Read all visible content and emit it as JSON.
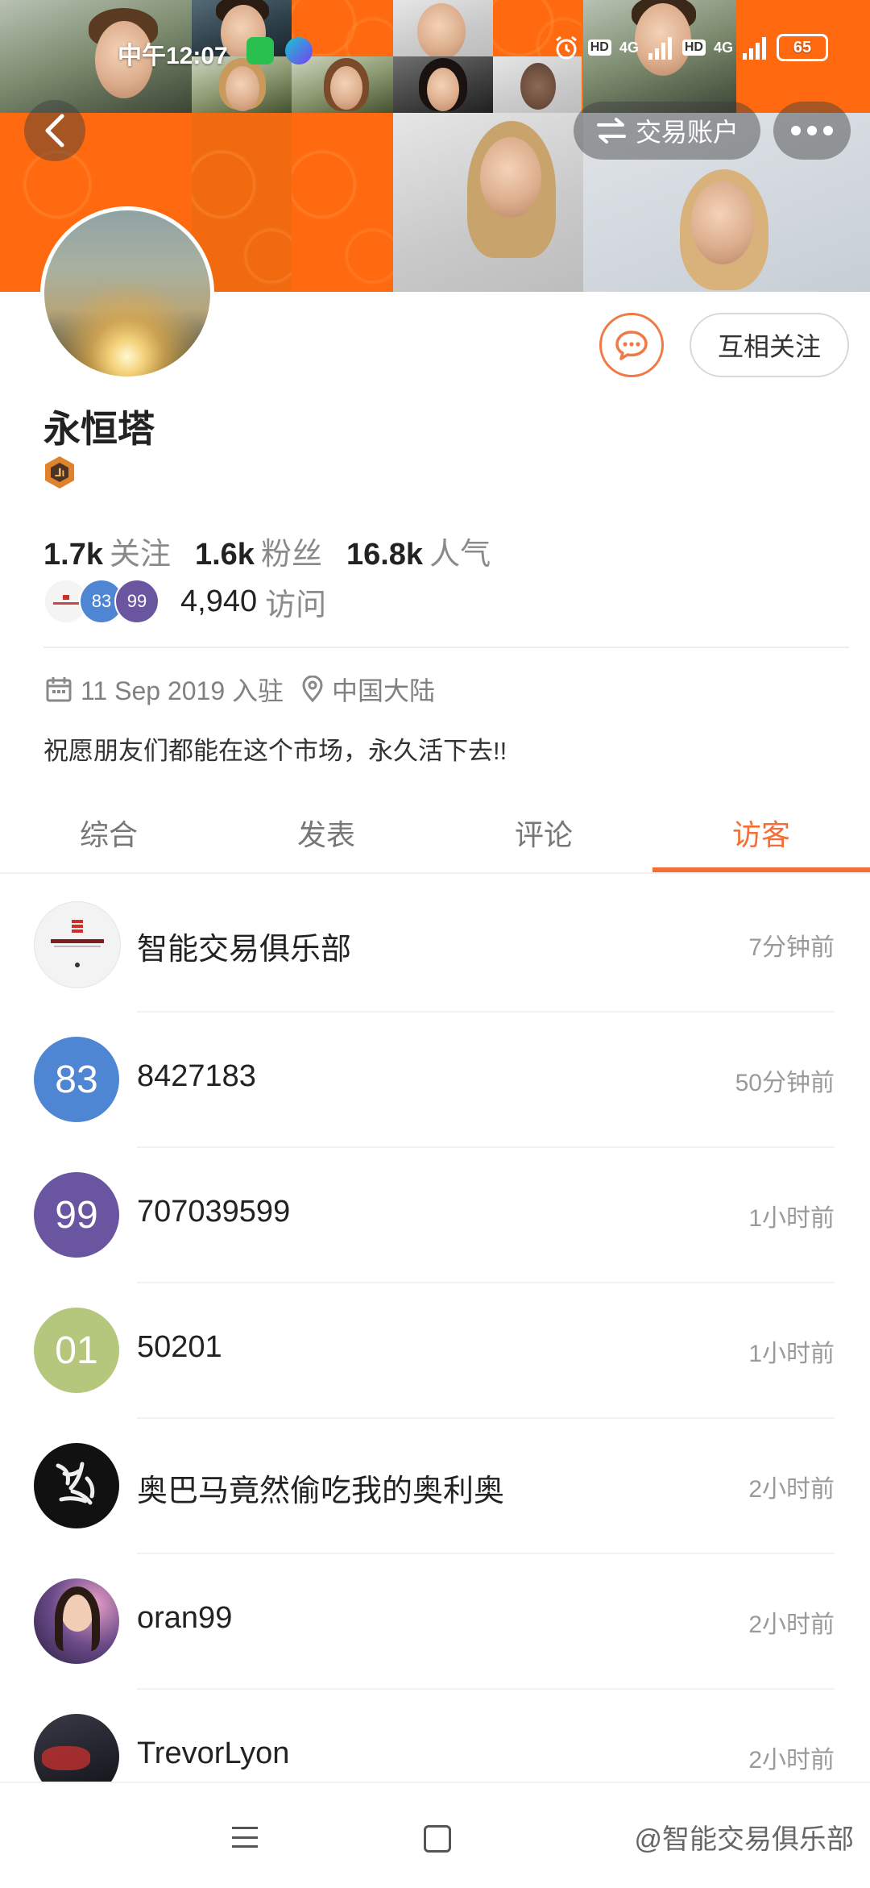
{
  "status_bar": {
    "time": "中午12:07",
    "battery": "65",
    "network_1": "4G",
    "network_2": "4G",
    "hd_1": "HD",
    "hd_2": "HD"
  },
  "header": {
    "switch_account": "交易账户"
  },
  "profile": {
    "username": "永恒塔",
    "follow_button": "互相关注",
    "stats": [
      {
        "value": "1.7k",
        "label": "关注"
      },
      {
        "value": "1.6k",
        "label": "粉丝"
      },
      {
        "value": "16.8k",
        "label": "人气"
      }
    ],
    "visitor_avatars": [
      "",
      "83",
      "99"
    ],
    "visit_count": "4,940",
    "visit_label": "访问",
    "joined": "11 Sep 2019 入驻",
    "location": "中国大陆",
    "bio": "祝愿朋友们都能在这个市场，永久活下去!!"
  },
  "tabs": [
    {
      "label": "综合",
      "active": false
    },
    {
      "label": "发表",
      "active": false
    },
    {
      "label": "评论",
      "active": false
    },
    {
      "label": "访客",
      "active": true
    }
  ],
  "visitors": [
    {
      "name": "智能交易俱乐部",
      "time": "7分钟前",
      "avatar_text": "",
      "avatar_color": "#f3f3f3",
      "avatar_kind": "logo"
    },
    {
      "name": "8427183",
      "time": "50分钟前",
      "avatar_text": "83",
      "avatar_color": "#4f86d3",
      "avatar_kind": "text"
    },
    {
      "name": "707039599",
      "time": "1小时前",
      "avatar_text": "99",
      "avatar_color": "#6a55a0",
      "avatar_kind": "text"
    },
    {
      "name": "50201",
      "time": "1小时前",
      "avatar_text": "01",
      "avatar_color": "#b5c77c",
      "avatar_kind": "text"
    },
    {
      "name": "奥巴马竟然偷吃我的奥利奥",
      "time": "2小时前",
      "avatar_text": "",
      "avatar_color": "#111111",
      "avatar_kind": "calligraphy"
    },
    {
      "name": "oran99",
      "time": "2小时前",
      "avatar_text": "",
      "avatar_color": "#5b4b78",
      "avatar_kind": "photo"
    },
    {
      "name": "TrevorLyon",
      "time": "2小时前",
      "avatar_text": "",
      "avatar_color": "#1f1f26",
      "avatar_kind": "photo"
    }
  ],
  "watermark": "@智能交易俱乐部",
  "colors": {
    "accent": "#f36f36",
    "banner": "#ff6d0c"
  }
}
